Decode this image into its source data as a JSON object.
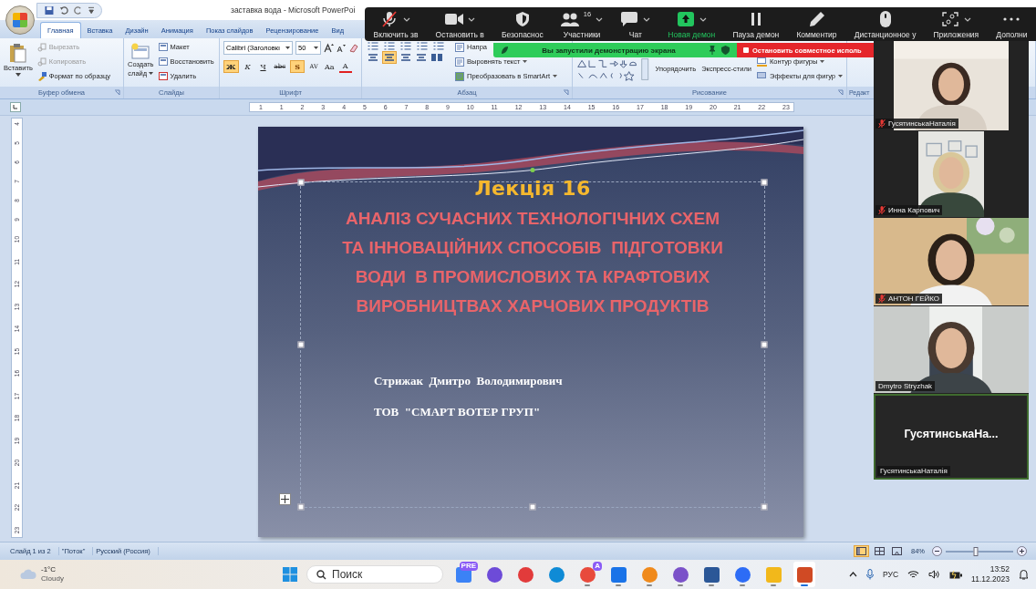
{
  "window": {
    "title": "заставка вода - Microsoft PowerPoi"
  },
  "ribbon": {
    "tabs": [
      {
        "label": "Главная",
        "selected": true
      },
      {
        "label": "Вставка",
        "selected": false
      },
      {
        "label": "Дизайн",
        "selected": false
      },
      {
        "label": "Анимация",
        "selected": false
      },
      {
        "label": "Показ слайдов",
        "selected": false
      },
      {
        "label": "Рецензирование",
        "selected": false
      },
      {
        "label": "Вид",
        "selected": false
      }
    ],
    "groups": [
      {
        "kind": "clipboard",
        "label": "Буфер обмена",
        "paste": "Вставить",
        "items": [
          {
            "label": "Вырезать",
            "disabled": true
          },
          {
            "label": "Копировать",
            "disabled": true
          },
          {
            "label": "Формат по образцу",
            "disabled": false
          }
        ]
      },
      {
        "kind": "slides",
        "label": "Слайды",
        "new_slide": [
          "Создать",
          "слайд"
        ],
        "items": [
          "Макет",
          "Восстановить",
          "Удалить"
        ]
      },
      {
        "kind": "font",
        "label": "Шрифт",
        "font": "Calibri (Заголовкı",
        "size": "50",
        "buttons": [
          {
            "kind": "bold",
            "label": "Ж",
            "selected": true
          },
          {
            "kind": "italic",
            "label": "К",
            "selected": false
          },
          {
            "kind": "underline",
            "label": "Ч",
            "selected": false
          },
          {
            "kind": "strike",
            "label": "abc",
            "selected": false
          },
          {
            "kind": "shadow",
            "label": "S",
            "selected": true
          },
          {
            "kind": "spacing",
            "label": "AV",
            "selected": false
          },
          {
            "kind": "case",
            "label": "Aa",
            "selected": false
          },
          {
            "kind": "color",
            "label": "A",
            "selected": false
          }
        ]
      },
      {
        "kind": "paragraph",
        "label": "Абзац",
        "items": [
          "Напра",
          "Выровнять текст",
          "Преобразовать в SmartArt"
        ],
        "align": [
          {
            "selected": false
          },
          {
            "selected": true
          },
          {
            "selected": false
          },
          {
            "selected": false
          }
        ]
      },
      {
        "kind": "drawing",
        "label": "Рисование",
        "arrange": "Упорядочить",
        "styles": "Экспресс-стили",
        "items": [
          "Контур фигуры",
          "Эффекты для фигур"
        ]
      },
      {
        "kind": "editing",
        "label": "Редакт"
      }
    ]
  },
  "rulers": {
    "horizontal": [
      "1",
      "1",
      "2",
      "3",
      "4",
      "5",
      "6",
      "7",
      "8",
      "9",
      "10",
      "11",
      "12",
      "13",
      "14",
      "15",
      "16",
      "17",
      "18",
      "19",
      "20",
      "21",
      "22",
      "23"
    ],
    "vertical": [
      "4",
      "5",
      "6",
      "7",
      "8",
      "9",
      "10",
      "11",
      "12",
      "13",
      "14",
      "15",
      "16",
      "17",
      "18",
      "19",
      "20",
      "21",
      "22",
      "23"
    ]
  },
  "slide": {
    "title": "Лекція 16",
    "heading": [
      "АНАЛІЗ СУЧАСНИХ ТЕХНОЛОГІЧНИХ СХЕМ",
      "ТА ІННОВАЦІЙНИХ СПОСОБІВ  ПІДГОТОВКИ",
      "ВОДИ  В ПРОМИСЛОВИХ ТА КРАФТОВИХ",
      "ВИРОБНИЦТВАХ ХАРЧОВИХ ПРОДУКТІВ"
    ],
    "author": "Стрижак  Дмитро  Володимирович",
    "company": "ТОВ  \"СМАРТ ВОТЕР ГРУП\""
  },
  "zoom": {
    "toolbar": [
      {
        "kind": "mic",
        "label": "Включить зв",
        "menu": true
      },
      {
        "kind": "video",
        "label": "Остановить в",
        "menu": true
      },
      {
        "kind": "security",
        "label": "Безопаснос",
        "menu": false
      },
      {
        "kind": "participants",
        "label": "Участники",
        "count": "16",
        "menu": true
      },
      {
        "kind": "chat",
        "label": "Чат",
        "menu": true
      },
      {
        "kind": "share",
        "label": "Новая демон",
        "menu": true
      },
      {
        "kind": "pause",
        "label": "Пауза демон",
        "menu": false
      },
      {
        "kind": "annotate",
        "label": "Комментир",
        "menu": false
      },
      {
        "kind": "remote",
        "label": "Дистанционное у",
        "menu": false
      },
      {
        "kind": "apps",
        "label": "Приложения",
        "menu": true
      },
      {
        "kind": "more",
        "label": "Дополни",
        "menu": false
      }
    ],
    "share_banner": {
      "text": "Вы запустили демонстрацию экрана",
      "stop": "Остановить совместное исполь"
    },
    "participants": [
      {
        "kind": "video",
        "name": "ГусятинськаНаталія",
        "muted": true,
        "speaking": false
      },
      {
        "kind": "video",
        "name": "Инна Карпович",
        "muted": true,
        "speaking": false
      },
      {
        "kind": "video",
        "name": "АНТОН ГЕЙКО",
        "muted": true,
        "speaking": false
      },
      {
        "kind": "video",
        "name": "Dmytro Stryzhak",
        "muted": false,
        "speaking": false
      },
      {
        "kind": "name",
        "display": "ГусятинськаНа...",
        "name": "ГусятинськаНаталія",
        "muted": false,
        "speaking": true
      }
    ]
  },
  "status_bar": {
    "items": [
      "Слайд 1 из 2",
      "\"Поток\"",
      "Русский (Россия)"
    ],
    "views": [
      {
        "selected": true
      },
      {
        "selected": false
      },
      {
        "selected": false
      }
    ],
    "zoom": "84%",
    "zoom_slider": {
      "level": 0.45
    }
  },
  "taskbar": {
    "weather": {
      "temp": "-1°C",
      "condition": "Cloudy"
    },
    "search": {
      "placeholder": "Поиск"
    },
    "apps": [
      {
        "kind": "copilot",
        "badge": "PRE",
        "running": false,
        "active": false
      },
      {
        "kind": "meet",
        "running": false,
        "active": false
      },
      {
        "kind": "red",
        "running": false,
        "active": false
      },
      {
        "kind": "edge",
        "running": false,
        "active": false
      },
      {
        "kind": "chrome",
        "badge": "A",
        "running": true,
        "active": false
      },
      {
        "kind": "mail",
        "running": true,
        "active": false
      },
      {
        "kind": "orange",
        "running": true,
        "active": false
      },
      {
        "kind": "viber",
        "running": true,
        "active": false
      },
      {
        "kind": "word",
        "running": true,
        "active": false
      },
      {
        "kind": "zoom",
        "running": true,
        "active": false
      },
      {
        "kind": "folder",
        "running": true,
        "active": false
      },
      {
        "kind": "ppt",
        "running": true,
        "active": true
      }
    ],
    "tray": {
      "language": "РУС",
      "time": "13:52",
      "date": "11.12.2023"
    }
  }
}
